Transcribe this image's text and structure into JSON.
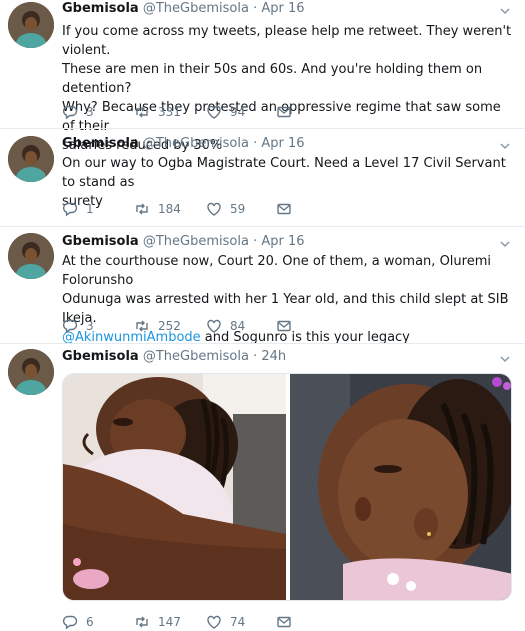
{
  "tweets": [
    {
      "name": "Gbemisola",
      "handle": "@TheGbemisola",
      "time": "· Apr 16",
      "lines": [
        "If you come across my tweets, please help me retweet. They weren't violent.",
        "These are men in their 50s and 60s. And you're holding them on detention?",
        "Why? Because they protested an oppressive regime that saw some of their",
        "salaries reduced by 30%"
      ],
      "replies": "3",
      "retweets": "331",
      "likes": "94"
    },
    {
      "name": "Gbemisola",
      "handle": "@TheGbemisola",
      "time": "· Apr 16",
      "lines": [
        "On our way to Ogba Magistrate Court. Need a Level 17 Civil Servant to stand as",
        "surety"
      ],
      "replies": "1",
      "retweets": "184",
      "likes": "59"
    },
    {
      "name": "Gbemisola",
      "handle": "@TheGbemisola",
      "time": "· Apr 16",
      "lines": [
        "At the courthouse now, Court 20. One of them, a woman, Oluremi Folorunsho",
        "Odunuga was arrested with her 1 Year old, and this child slept at SIB Ikeja."
      ],
      "mention": "@AkinwunmiAmbode",
      "mention_rest": " and Sogunro is this your legacy",
      "replies": "3",
      "retweets": "252",
      "likes": "84"
    },
    {
      "name": "Gbemisola",
      "handle": "@TheGbemisola",
      "time": "· 24h",
      "replies": "6",
      "retweets": "147",
      "likes": "74"
    }
  ],
  "colors": {
    "link": "#1b95e0",
    "muted": "#657786",
    "border": "#e6ecf0"
  }
}
